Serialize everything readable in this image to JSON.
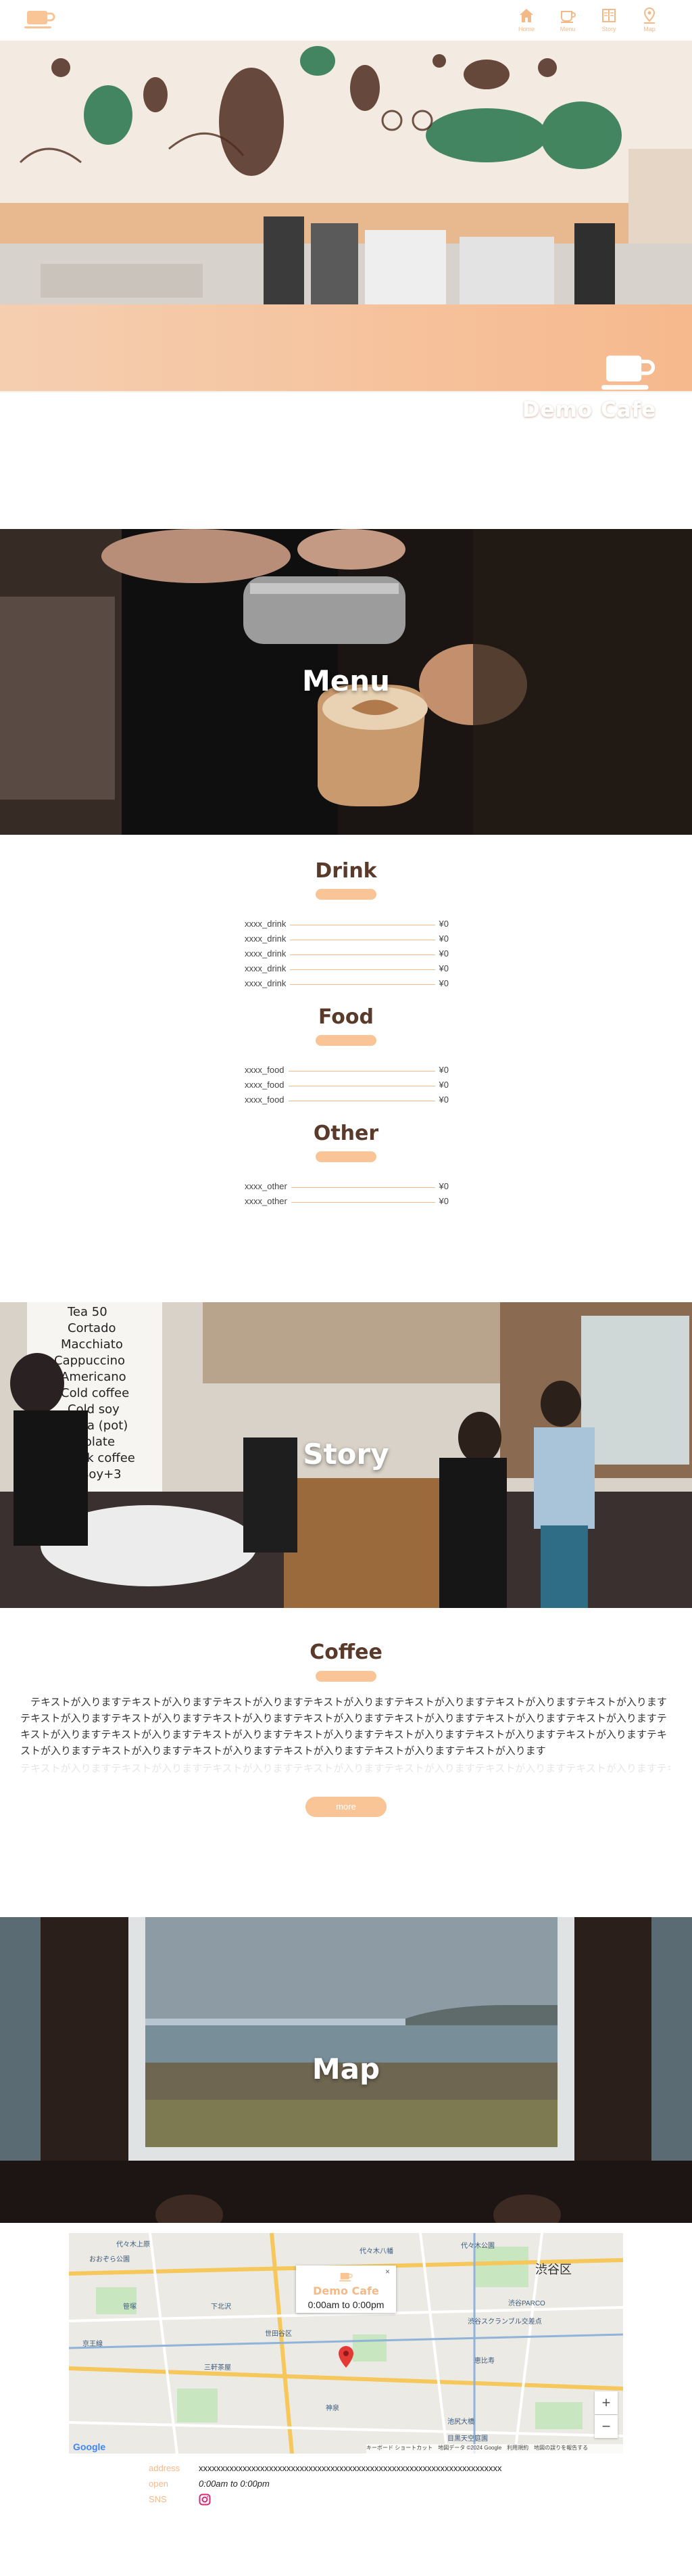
{
  "nav": {
    "items": [
      {
        "label": "Home",
        "icon": "home-icon"
      },
      {
        "label": "Menu",
        "icon": "coffee-cup-icon"
      },
      {
        "label": "Story",
        "icon": "book-icon"
      },
      {
        "label": "Map",
        "icon": "map-pin-icon"
      }
    ]
  },
  "hero": {
    "brand": "Demo Cafe"
  },
  "sections": {
    "menu_title": "Menu",
    "story_title": "Story",
    "map_title": "Map"
  },
  "menu": {
    "categories": [
      {
        "title": "Drink",
        "items": [
          {
            "name": "xxxx_drink",
            "price": "¥0"
          },
          {
            "name": "xxxx_drink",
            "price": "¥0"
          },
          {
            "name": "xxxx_drink",
            "price": "¥0"
          },
          {
            "name": "xxxx_drink",
            "price": "¥0"
          },
          {
            "name": "xxxx_drink",
            "price": "¥0"
          }
        ]
      },
      {
        "title": "Food",
        "items": [
          {
            "name": "xxxx_food",
            "price": "¥0"
          },
          {
            "name": "xxxx_food",
            "price": "¥0"
          },
          {
            "name": "xxxx_food",
            "price": "¥0"
          }
        ]
      },
      {
        "title": "Other",
        "items": [
          {
            "name": "xxxx_other",
            "price": "¥0"
          },
          {
            "name": "xxxx_other",
            "price": "¥0"
          }
        ]
      }
    ]
  },
  "story": {
    "heading": "Coffee",
    "text": "テキストが入りますテキストが入りますテキストが入りますテキストが入りますテキストが入りますテキストが入りますテキストが入りますテキストが入りますテキストが入りますテキストが入りますテキストが入りますテキストが入りますテキストが入りますテキストが入りますテキストが入りますテキストが入りますテキストが入りますテキストが入りますテキストが入りますテキストが入りますテキストが入りますテキストが入りますテキストが入りますテキストが入りますテキストが入りますテキストが入りますテキストが入ります",
    "faded_text": "テキストが入りますテキストが入りますテキストが入りますテキストが入りますテキストが入りますテキストが入りますテキストが入りますテキストが入ります",
    "more_label": "more"
  },
  "map": {
    "district": "渋谷区",
    "places": [
      "代々木上原",
      "代々木公園",
      "渋谷PARCO",
      "渋谷スクランブル交差点",
      "恵比寿",
      "池尻大橋",
      "三軒茶屋",
      "世田谷区",
      "目黒天空庭園",
      "おおぞら公園",
      "京王線",
      "笹塚",
      "下北沢",
      "代々木八幡",
      "神泉"
    ],
    "popup_brand": "Demo Cafe",
    "popup_hours": "0:00am to 0:00pm",
    "zoom_in": "+",
    "zoom_out": "−",
    "google": "Google",
    "attribution": "キーボード ショートカット　地図データ ©2024 Google　利用規約　地図の誤りを報告する"
  },
  "info": {
    "address_label": "address",
    "address_value": "xxxxxxxxxxxxxxxxxxxxxxxxxxxxxxxxxxxxxxxxxxxxxxxxxxxxxxxxxxxxxxxxxxxxx",
    "open_label": "open",
    "open_value": "0:00am to 0:00pm",
    "sns_label": "SNS"
  },
  "colors": {
    "accent": "#f9c597",
    "accent_text": "#f5b987",
    "title_brown": "#5a3a2a"
  }
}
